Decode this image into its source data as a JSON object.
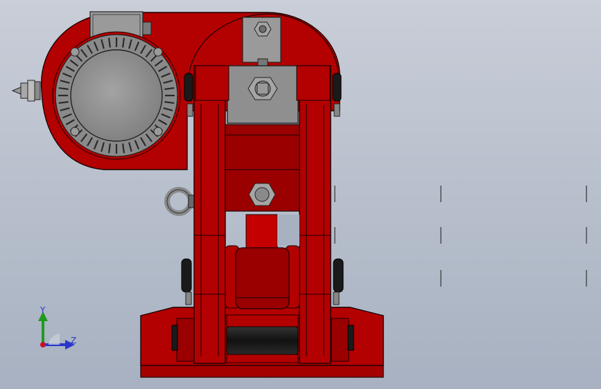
{
  "viewport": {
    "background_top": "#c9ced8",
    "background_bottom": "#a7b1c1"
  },
  "model": {
    "body_color": "#b30000",
    "body_dark": "#7a0000",
    "edge_color": "#1a0000",
    "metal_color": "#8f8f8f",
    "metal_light": "#b5b5b5",
    "rubber_color": "#1a1a1a"
  },
  "triad": {
    "y_label": "Y",
    "z_label": "Z",
    "y_color": "#1f9a1f",
    "z_color": "#2a36c8",
    "origin_color": "#c8102e"
  }
}
